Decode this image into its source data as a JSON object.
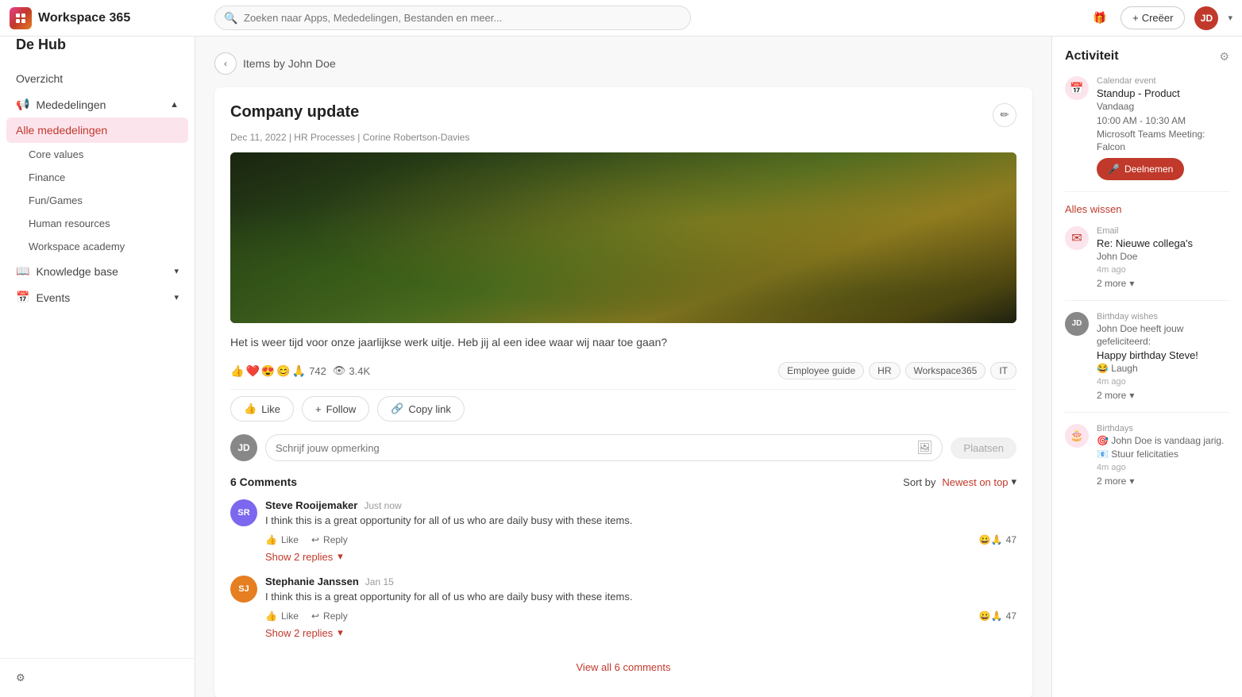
{
  "app": {
    "name": "Workspace 365",
    "search_placeholder": "Zoeken naar Apps, Mededelingen, Bestanden en meer..."
  },
  "header": {
    "create_label": "Creëer",
    "avatar_initials": "JD"
  },
  "sidebar": {
    "title": "De Hub",
    "overview_label": "Overzicht",
    "sections": [
      {
        "label": "Mededelingen",
        "icon": "📢",
        "sub_items": [
          "Alle mededelingen",
          "Core values",
          "Finance",
          "Fun/Games",
          "Human resources",
          "Workspace academy"
        ]
      },
      {
        "label": "Knowledge base",
        "icon": "📖",
        "sub_items": []
      },
      {
        "label": "Events",
        "icon": "📅",
        "sub_items": []
      }
    ],
    "active_item": "Alle mededelingen",
    "settings_label": "⚙"
  },
  "breadcrumb": {
    "back_label": "‹",
    "path": "Items by John Doe"
  },
  "post": {
    "title": "Company update",
    "meta": "Dec 11, 2022 | HR Processes | Corine Robertson-Davies",
    "body": "Het is weer tijd voor onze jaarlijkse werk uitje. Heb jij al een idee waar wij naar toe gaan?",
    "reactions": {
      "emojis": [
        "👍",
        "❤️",
        "😍",
        "😊",
        "🙏"
      ],
      "count": "742",
      "views_icon": "👁",
      "views_count": "3.4K"
    },
    "tags": [
      "Employee guide",
      "HR",
      "Workspace365",
      "IT"
    ],
    "actions": {
      "like_label": "Like",
      "follow_label": "Follow",
      "copy_label": "Copy link"
    },
    "comment_placeholder": "Schrijf jouw opmerking",
    "post_btn_label": "Plaatsen",
    "comments_count": "6 Comments",
    "sort_label": "Sort by",
    "sort_value": "Newest on top"
  },
  "comments": [
    {
      "author": "Steve Rooijemaker",
      "time": "Just now",
      "text": "I think this is a great opportunity for all of us who are daily busy with these items.",
      "like_label": "Like",
      "reply_label": "Reply",
      "emojis": "😀🙏",
      "emoji_count": "47",
      "show_replies_label": "Show 2 replies"
    },
    {
      "author": "Stephanie Janssen",
      "time": "Jan 15",
      "text": "I think this is a great opportunity for all of us who are daily busy with these items.",
      "like_label": "Like",
      "reply_label": "Reply",
      "emojis": "😀🙏",
      "emoji_count": "47",
      "show_replies_label": "Show 2 replies"
    }
  ],
  "view_all_label": "View all 6 comments",
  "activity": {
    "title": "Activiteit",
    "items": [
      {
        "type": "Calendar event",
        "icon": "📅",
        "icon_type": "red",
        "main": "Standup - Product",
        "sub1": "Vandaag",
        "sub2": "10:00 AM - 10:30 AM",
        "sub3": "Microsoft Teams Meeting: Falcon",
        "action_label": "Deelnemen",
        "action_icon": "🎤"
      },
      {
        "type": "",
        "special": "alles_wissen",
        "label": "Alles wissen"
      },
      {
        "type": "Email",
        "icon": "✉",
        "icon_type": "red",
        "main": "Re: Nieuwe collega's",
        "sub1": "John Doe",
        "sub2": "4m ago",
        "more_label": "2 more"
      },
      {
        "type": "Birthday wishes",
        "icon": "🎂",
        "icon_type": "avatar",
        "avatar_initials": "JD",
        "main": "Birthday wishes",
        "sub1": "John Doe heeft jouw gefeliciteerd:",
        "sub2": "Happy birthday Steve!",
        "sub3": "😂 Laugh",
        "sub4": "4m ago",
        "more_label": "2 more"
      },
      {
        "type": "Birthdays",
        "icon": "🎂",
        "icon_type": "red",
        "main": "Birthdays",
        "sub1": "🎯 John Doe is vandaag jarig.",
        "sub2": "📧 Stuur felicitaties",
        "sub3": "4m ago",
        "more_label": "2 more"
      }
    ]
  }
}
